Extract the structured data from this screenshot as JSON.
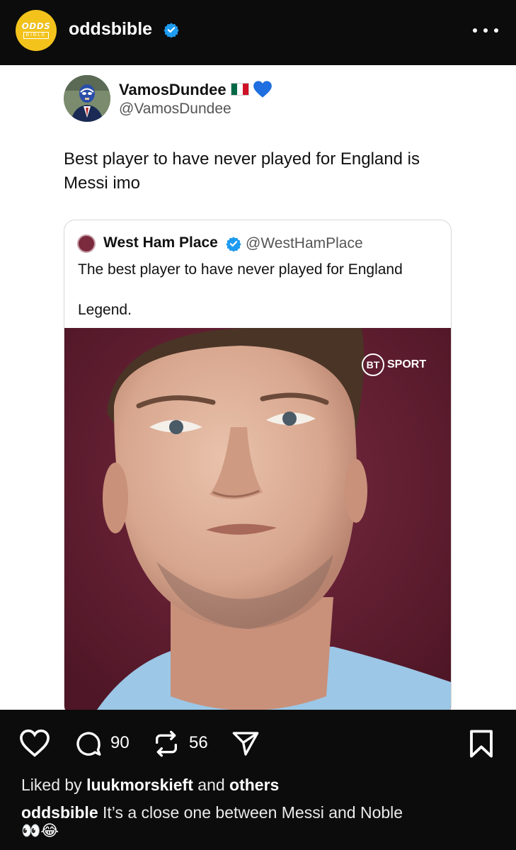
{
  "header": {
    "brand_logo_line1": "ODDS",
    "brand_logo_line2": "BIBLE",
    "account_name": "oddsbible"
  },
  "tweet": {
    "display_name": "VamosDundee",
    "handle": "@VamosDundee",
    "text": "Best player to have never played for England is Messi imo",
    "quoted": {
      "display_name": "West Ham Place",
      "handle": "@WestHamPlace",
      "text_line1": "The best player to have never played for England",
      "text_line2": "Legend.",
      "media_watermark_bt": "BT",
      "media_watermark_sport": "SPORT"
    }
  },
  "actions": {
    "comment_count": "90",
    "repost_count": "56"
  },
  "likes": {
    "prefix": "Liked by",
    "user": "luukmorskieft",
    "and": "and",
    "others": "others"
  },
  "caption": {
    "user": "oddsbible",
    "text": "It’s a close one between Messi and Noble",
    "emoji": "👀😂"
  },
  "colors": {
    "brand_yellow": "#f3c31c",
    "verified_blue": "#1d9bf0",
    "quote_media_bg": "#6b2238"
  }
}
